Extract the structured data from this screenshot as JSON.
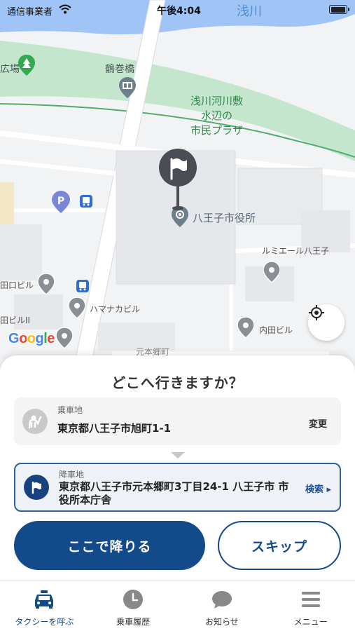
{
  "status_bar": {
    "carrier": "通信事業者",
    "time": "午後4:04",
    "battery_level": 1.0
  },
  "map": {
    "labels": {
      "river": "浅川",
      "bridge": "鶴巻橋",
      "park": "浅川河川敷\n水辺の\n市民プラザ",
      "park_edge": "広場",
      "cityhall": "八王子市役所",
      "lumiere": "ルミエール八王子",
      "building_left1": "田口ビル",
      "hamanaka": "ハマナカビル",
      "building_left2": "田ビルII",
      "uchida": "内田ビル",
      "district": "元本郷町"
    },
    "icons": {
      "destination_marker": "flag-icon",
      "park_marker": "tree-icon",
      "bridge_marker": "bridge-icon",
      "parking_marker": "parking-icon",
      "bus_marker": "bus-icon",
      "locate": "crosshair-icon"
    },
    "google_letters": [
      "G",
      "o",
      "o",
      "g",
      "l",
      "e"
    ]
  },
  "sheet": {
    "title": "どこへ行きますか？",
    "pickup": {
      "caption": "乗車地",
      "address": "東京都八王子市旭町1-1",
      "action": "変更"
    },
    "dropoff": {
      "caption": "降車地",
      "address": "東京都八王子市元本郷町3丁目24-1 八王子市 市役所本庁舎",
      "action": "検索 ▸"
    },
    "primary_button": "ここで降りる",
    "secondary_button": "スキップ"
  },
  "tabs": [
    {
      "label": "タクシーを呼ぶ",
      "icon": "taxi-icon",
      "active": true
    },
    {
      "label": "乗車履歴",
      "icon": "clock-icon",
      "active": false
    },
    {
      "label": "お知らせ",
      "icon": "chat-bubble-icon",
      "active": false
    },
    {
      "label": "メニュー",
      "icon": "hamburger-menu-icon",
      "active": false
    }
  ],
  "colors": {
    "brand": "#124a8a",
    "river": "#9fc4f5",
    "park": "#c3e6cd",
    "map_bg": "#f2f3f4"
  }
}
